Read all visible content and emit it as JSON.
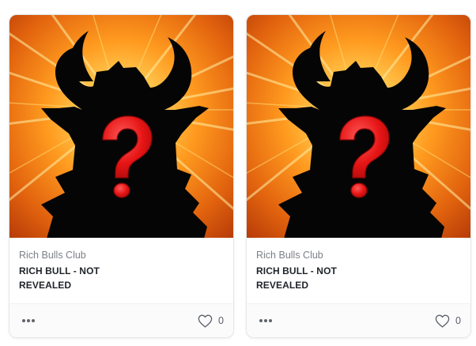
{
  "cards": [
    {
      "collection": "Rich Bulls Club",
      "title": "RICH BULL - NOT REVEALED",
      "like_count": "0",
      "image": {
        "kind": "placeholder-silhouette",
        "description_icon": "bull-silhouette-question-mark"
      }
    },
    {
      "collection": "Rich Bulls Club",
      "title": "RICH BULL - NOT REVEALED",
      "like_count": "0",
      "image": {
        "kind": "placeholder-silhouette",
        "description_icon": "bull-silhouette-question-mark"
      }
    }
  ],
  "icons": {
    "more": "more-horizontal-icon",
    "like": "heart-outline-icon"
  },
  "colors": {
    "burst_center": "#fff3b0",
    "burst_mid": "#ff9a1f",
    "burst_edge": "#c2410c",
    "silhouette": "#050505",
    "question_mark": "#ef1b1b"
  }
}
